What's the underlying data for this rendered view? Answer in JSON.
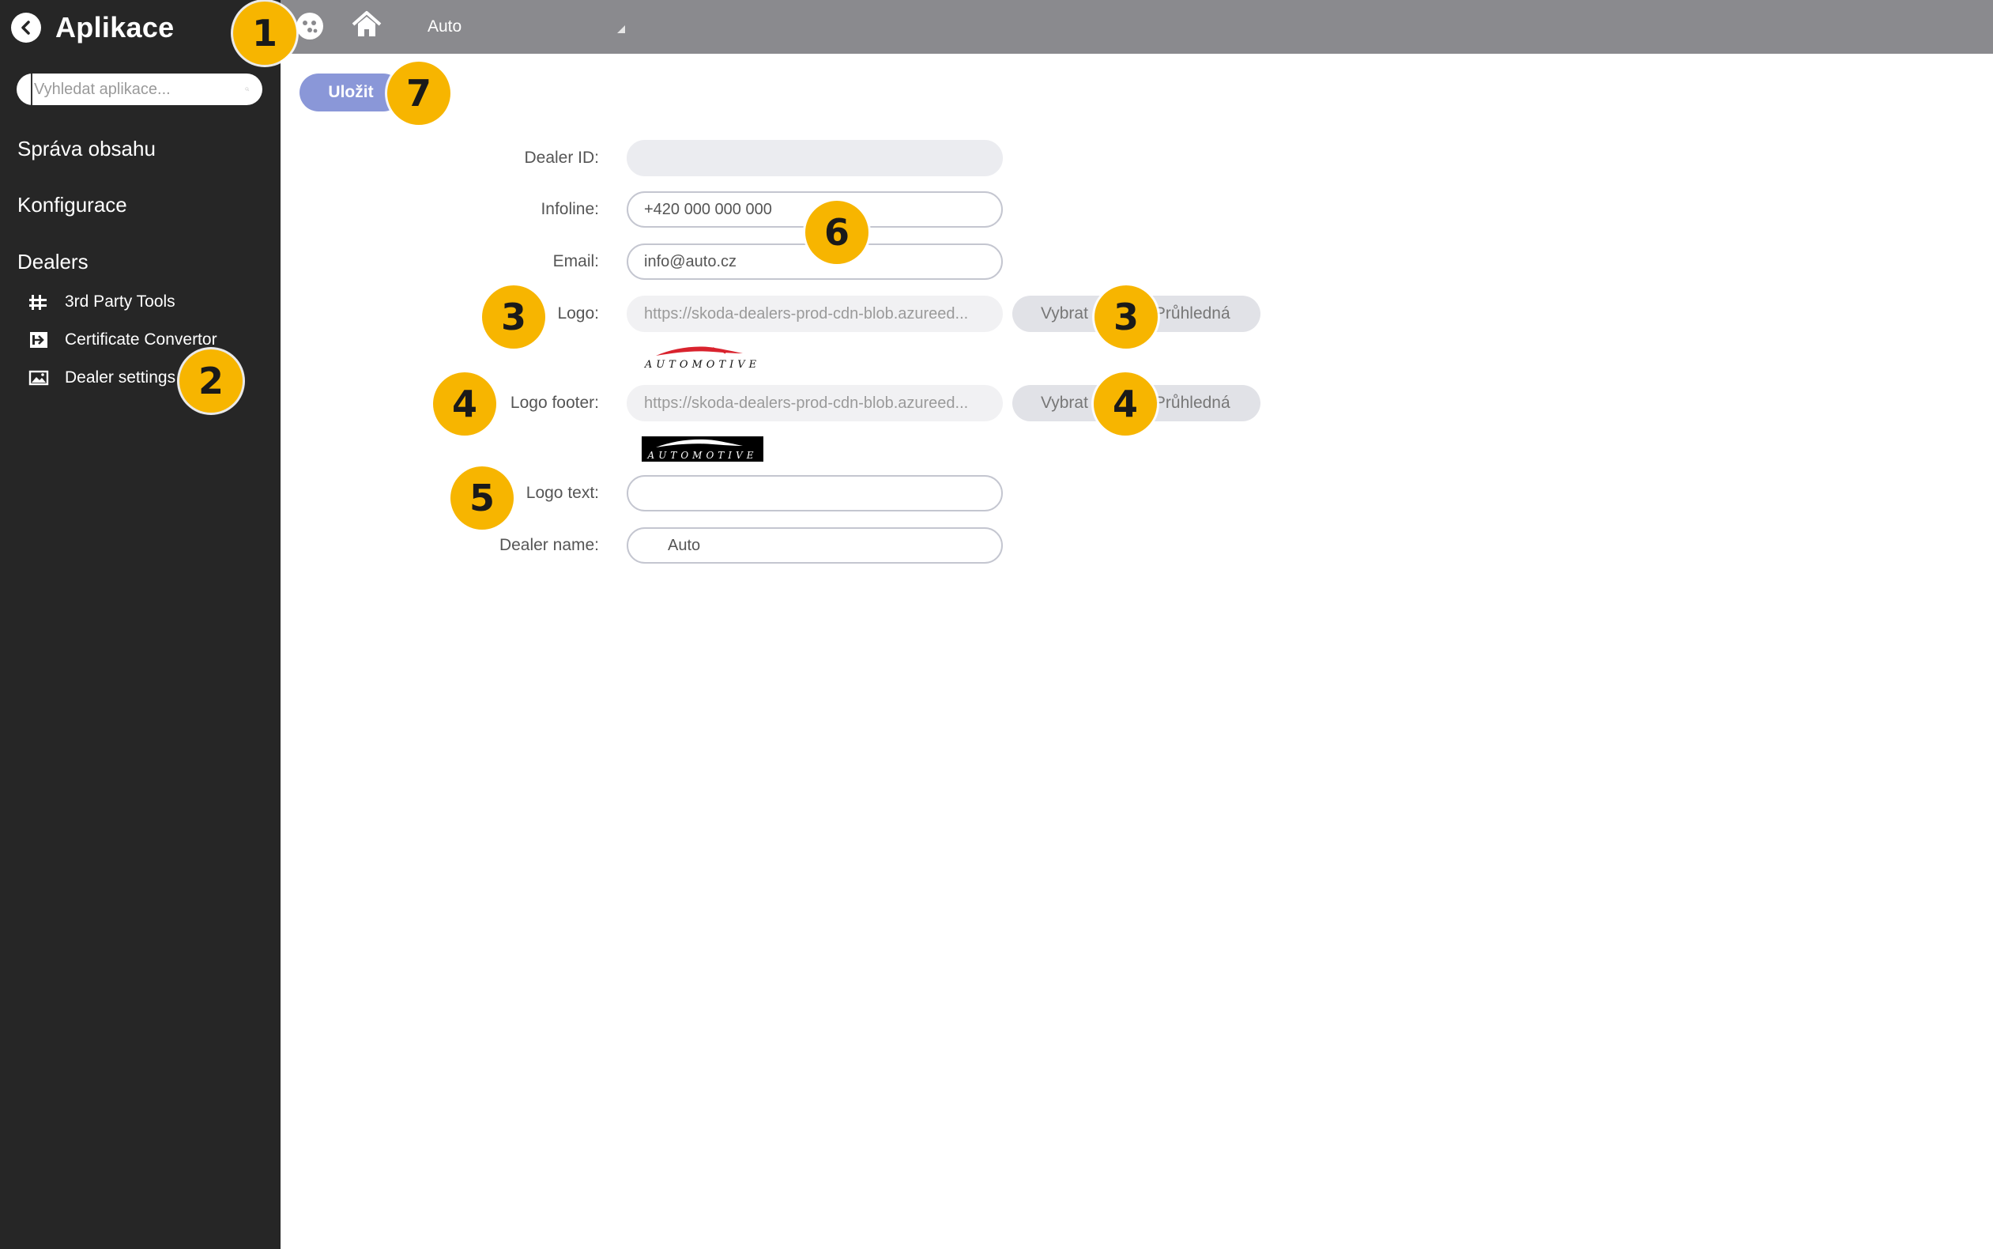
{
  "sidebar": {
    "title": "Aplikace",
    "search_placeholder": "Vyhledat aplikace...",
    "sections": [
      "Správa obsahu",
      "Konfigurace",
      "Dealers"
    ],
    "items": [
      {
        "label": "3rd Party Tools",
        "icon": "tools-icon"
      },
      {
        "label": "Certificate Convertor",
        "icon": "convert-icon"
      },
      {
        "label": "Dealer settings",
        "icon": "image-icon"
      }
    ]
  },
  "topbar": {
    "icons": [
      "apps-icon",
      "home-icon"
    ],
    "dealer_select": "Auto"
  },
  "toolbar": {
    "save_label": "Uložit"
  },
  "form": {
    "dealer_id": {
      "label": "Dealer ID:",
      "value": ""
    },
    "infoline": {
      "label": "Infoline:",
      "value": "+420 000 000 000"
    },
    "email": {
      "label": "Email:",
      "value": "info@auto.cz"
    },
    "logo": {
      "label": "Logo:",
      "value": "https://skoda-dealers-prod-cdn-blob.azureed...",
      "select_label": "Vybrat",
      "transparent_label": "Průhledná",
      "preview_text": "AUTOMOTIVE"
    },
    "logo_footer": {
      "label": "Logo footer:",
      "value": "https://skoda-dealers-prod-cdn-blob.azureed...",
      "select_label": "Vybrat",
      "transparent_label": "Průhledná",
      "preview_text": "AUTOMOTIVE"
    },
    "logo_text": {
      "label": "Logo text:",
      "value": ""
    },
    "dealer_name": {
      "label": "Dealer name:",
      "value": "Auto"
    }
  },
  "annotations": [
    "1",
    "2",
    "3",
    "3",
    "4",
    "4",
    "5",
    "6",
    "7"
  ],
  "colors": {
    "sidebar_bg": "#262626",
    "topbar_bg": "#8a8a8e",
    "save_button": "#8a97d8",
    "badge": "#f7b500",
    "logo_red": "#d9232e"
  }
}
